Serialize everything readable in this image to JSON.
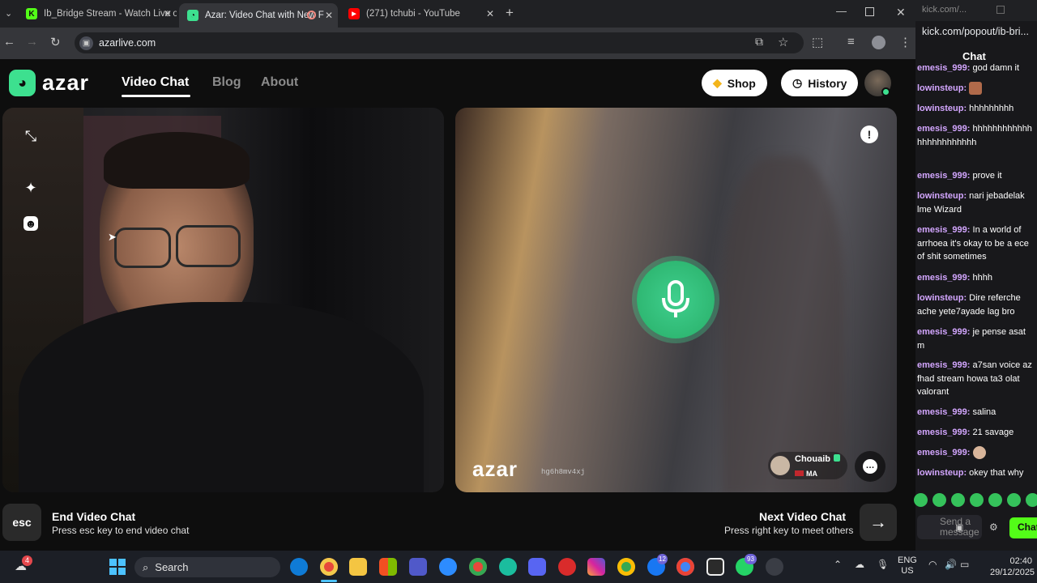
{
  "browser": {
    "tabs": [
      {
        "title": "Ib_Bridge Stream - Watch Live o",
        "favicon": "kick-icon",
        "color": "#53fc18"
      },
      {
        "title": "Azar: Video Chat with New F",
        "favicon": "azar-icon",
        "color": "#3de08f"
      },
      {
        "title": "(271) tchubi - YouTube",
        "favicon": "youtube-icon",
        "color": "#ff0000"
      }
    ],
    "url": "azarlive.com"
  },
  "site": {
    "brand": "azar",
    "nav": [
      "Video Chat",
      "Blog",
      "About"
    ],
    "shop_label": "Shop",
    "history_label": "History"
  },
  "call": {
    "watermark": "azar",
    "code": "hg6h8mv4xj",
    "partner_name": "Chouaib",
    "partner_country": "MA"
  },
  "controls": {
    "esc_key": "esc",
    "end_title": "End Video Chat",
    "end_sub": "Press esc key to end video chat",
    "next_title": "Next Video Chat",
    "next_sub": "Press right key to meet others"
  },
  "kick": {
    "url": "kick.com/popout/ib-bri...",
    "url_top": "kick.com/...",
    "title": "Chat",
    "messages": [
      {
        "user": "emesis_999:",
        "text": "god damn it"
      },
      {
        "user": "lowinsteup:",
        "text": ""
      },
      {
        "user": "lowinsteup:",
        "text": "hhhhhhhhh"
      },
      {
        "user": "emesis_999:",
        "text": "hhhhhhhhhhhhhhhhhhhhhhhh"
      },
      {
        "user": "emesis_999:",
        "text": "prove it"
      },
      {
        "user": "lowinsteup:",
        "text": "nari jebadelak lme Wizard"
      },
      {
        "user": "emesis_999:",
        "text": "In a world of arrhoea it's okay to be a ece of shit sometimes"
      },
      {
        "user": "emesis_999:",
        "text": "hhhh"
      },
      {
        "user": "lowinsteup:",
        "text": "Dire referche ache yete7ayade lag bro"
      },
      {
        "user": "emesis_999:",
        "text": "je pense asat m"
      },
      {
        "user": "emesis_999:",
        "text": "a7san voice az fhad stream howa ta3 olat valorant"
      },
      {
        "user": "emesis_999:",
        "text": "salina"
      },
      {
        "user": "emesis_999:",
        "text": "21 savage"
      },
      {
        "user": "emesis_999:",
        "text": ""
      },
      {
        "user": "lowinsteup:",
        "text": "okey that why"
      }
    ],
    "input_placeholder": "Send a message",
    "send_label": "Chat"
  },
  "taskbar": {
    "search_label": "Search",
    "notif_count": "4",
    "facebook_badge": "12",
    "whatsapp_badge": "93",
    "lang": "ENG",
    "region": "US",
    "time": "02:40",
    "date": "29/12/2025"
  }
}
